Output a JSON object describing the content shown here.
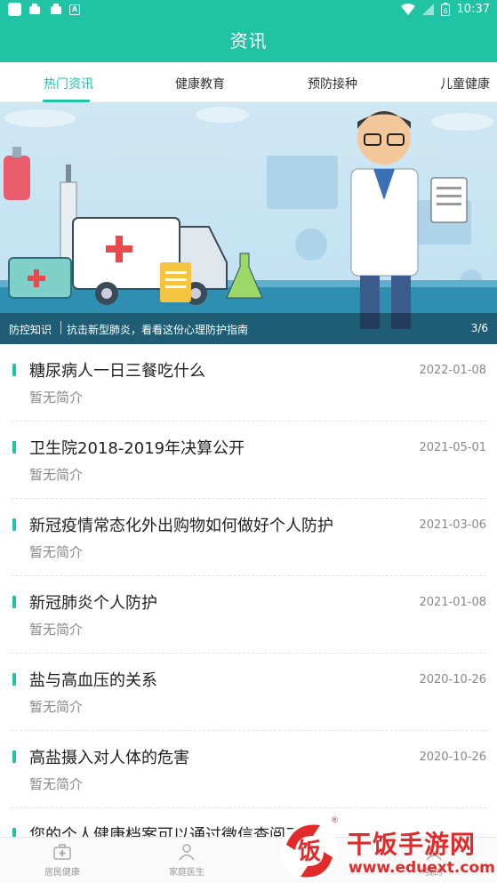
{
  "status_bar": {
    "time": "10:37",
    "battery_level": "6"
  },
  "header": {
    "title": "资讯"
  },
  "tabs": [
    {
      "label": "热门资讯",
      "active": true
    },
    {
      "label": "健康教育",
      "active": false
    },
    {
      "label": "预防接种",
      "active": false
    },
    {
      "label": "儿童健康",
      "active": false
    }
  ],
  "banner": {
    "category": "防控知识",
    "title": "抗击新型肺炎，看看这份心理防护指南",
    "page_indicator": "3/6"
  },
  "news": [
    {
      "title": "糖尿病人一日三餐吃什么",
      "date": "2022-01-08",
      "summary": "暂无简介"
    },
    {
      "title": "卫生院2018-2019年决算公开",
      "date": "2021-05-01",
      "summary": "暂无简介"
    },
    {
      "title": "新冠疫情常态化外出购物如何做好个人防护",
      "date": "2021-03-06",
      "summary": "暂无简介"
    },
    {
      "title": "新冠肺炎个人防护",
      "date": "2021-01-08",
      "summary": "暂无简介"
    },
    {
      "title": "盐与高血压的关系",
      "date": "2020-10-26",
      "summary": "暂无简介"
    },
    {
      "title": "高盐摄入对人体的危害",
      "date": "2020-10-26",
      "summary": "暂无简介"
    },
    {
      "title": "您的个人健康档案可以通过微信查阅了",
      "date": "",
      "summary": ""
    }
  ],
  "bottom_nav": [
    {
      "label": "居民健康",
      "icon": "medical-box-icon"
    },
    {
      "label": "家庭医生",
      "icon": "doctor-icon"
    },
    {
      "label": "资讯",
      "icon": "news-icon"
    },
    {
      "label": "我的",
      "icon": "user-icon"
    }
  ],
  "watermark": {
    "brand": "干饭手游网",
    "url": "www.eduext.com",
    "logo_letter": "饭"
  },
  "colors": {
    "accent": "#21c3a5",
    "watermark": "#e12b2b"
  }
}
